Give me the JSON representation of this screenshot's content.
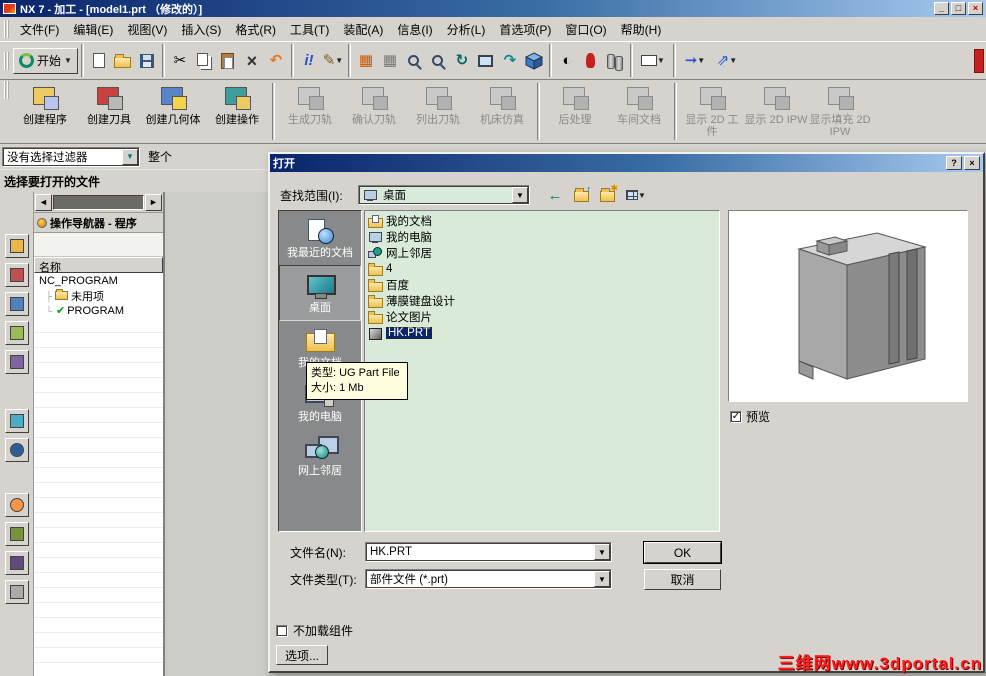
{
  "window": {
    "title": "NX 7 - 加工 - [model1.prt （修改的）]"
  },
  "menu": {
    "items": [
      "文件(F)",
      "编辑(E)",
      "视图(V)",
      "插入(S)",
      "格式(R)",
      "工具(T)",
      "装配(A)",
      "信息(I)",
      "分析(L)",
      "首选项(P)",
      "窗口(O)",
      "帮助(H)"
    ]
  },
  "toolbar1": {
    "start_label": "开始"
  },
  "toolbar2": {
    "buttons": [
      {
        "label": "创建程序"
      },
      {
        "label": "创建刀具"
      },
      {
        "label": "创建几何体"
      },
      {
        "label": "创建操作"
      },
      {
        "label": "生成刀轨"
      },
      {
        "label": "确认刀轨"
      },
      {
        "label": "列出刀轨"
      },
      {
        "label": "机床仿真"
      },
      {
        "label": "后处理"
      },
      {
        "label": "车间文档"
      },
      {
        "label": "显示 2D 工件"
      },
      {
        "label": "显示 2D IPW"
      },
      {
        "label": "显示填充 2D IPW"
      }
    ]
  },
  "filter": {
    "value": "没有选择过滤器",
    "scope": "整个"
  },
  "cue": "选择要打开的文件",
  "navigator": {
    "title": "操作导航器 - 程序",
    "column_name": "名称",
    "items": [
      "NC_PROGRAM",
      "未用项",
      "PROGRAM"
    ]
  },
  "dialog": {
    "title": "打开",
    "look_in_label": "查找范围(I):",
    "look_in_value": "桌面",
    "places": [
      "我最近的文档",
      "桌面",
      "我的文档",
      "我的电脑",
      "网上邻居"
    ],
    "files": [
      {
        "name": "我的文档"
      },
      {
        "name": "我的电脑"
      },
      {
        "name": "网上邻居"
      },
      {
        "name": "4"
      },
      {
        "name": "百度"
      },
      {
        "name": "薄膜键盘设计"
      },
      {
        "name": "论文图片"
      },
      {
        "name": "HK.PRT"
      }
    ],
    "tooltip": {
      "type_line": "类型: UG Part File",
      "size_line": "大小: 1 Mb"
    },
    "preview_label": "预览",
    "filename_label": "文件名(N):",
    "filename_value": "HK.PRT",
    "filetype_label": "文件类型(T):",
    "filetype_value": "部件文件 (*.prt)",
    "ok_label": "OK",
    "cancel_label": "取消",
    "noload_label": "不加载组件",
    "options_label": "选项..."
  },
  "watermark": "三维网www.3dportal.cn"
}
